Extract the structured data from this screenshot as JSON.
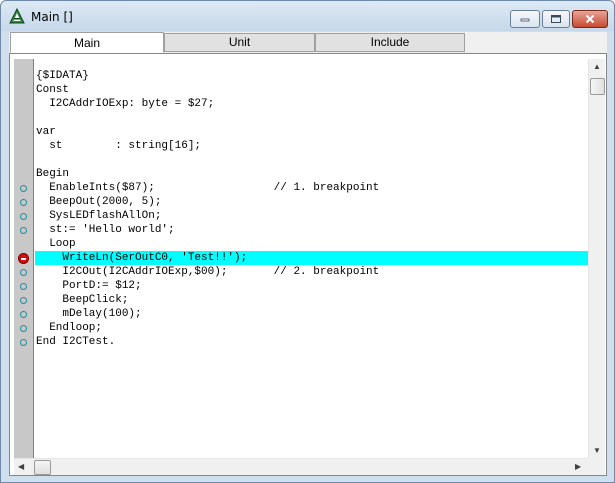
{
  "window": {
    "title": "Main []",
    "icon": "a-triangle-app-icon"
  },
  "tabs": [
    {
      "label": "Main",
      "active": true
    },
    {
      "label": "Unit",
      "active": false
    },
    {
      "label": "Include",
      "active": false
    }
  ],
  "editor": {
    "highlight_color": "#00ffff",
    "lines": [
      {
        "text": "{$IDATA}",
        "marker": "none"
      },
      {
        "text": "Const",
        "marker": "none"
      },
      {
        "text": "  I2CAddrIOExp: byte = $27;",
        "marker": "none"
      },
      {
        "text": "",
        "marker": "none"
      },
      {
        "text": "var",
        "marker": "none"
      },
      {
        "text": "  st        : string[16];",
        "marker": "none"
      },
      {
        "text": "",
        "marker": "none"
      },
      {
        "text": "Begin",
        "marker": "none"
      },
      {
        "text": "  EnableInts($87);                  // 1. breakpoint",
        "marker": "dot"
      },
      {
        "text": "  BeepOut(2000, 5);",
        "marker": "dot"
      },
      {
        "text": "  SysLEDflashAllOn;",
        "marker": "dot"
      },
      {
        "text": "  st:= 'Hello world';",
        "marker": "dot"
      },
      {
        "text": "  Loop",
        "marker": "none"
      },
      {
        "text": "    WriteLn(SerOutC0, 'Test!!');",
        "marker": "stop",
        "highlight": true
      },
      {
        "text": "    I2COut(I2CAddrIOExp,$00);       // 2. breakpoint",
        "marker": "dot"
      },
      {
        "text": "    PortD:= $12;",
        "marker": "dot"
      },
      {
        "text": "    BeepClick;",
        "marker": "dot"
      },
      {
        "text": "    mDelay(100);",
        "marker": "dot"
      },
      {
        "text": "  Endloop;",
        "marker": "dot"
      },
      {
        "text": "End I2CTest.",
        "marker": "dot"
      }
    ]
  }
}
